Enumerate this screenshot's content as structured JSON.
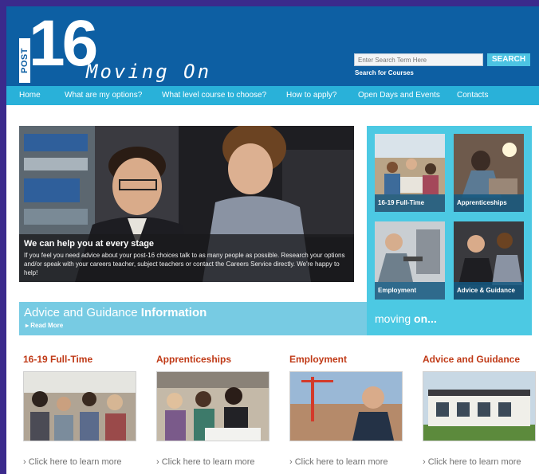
{
  "logo": {
    "post": "POST",
    "number": "16",
    "tagline": "Moving On"
  },
  "search": {
    "placeholder": "Enter Search Term Here",
    "button_label": "SEARCH",
    "courses_link": "Search for Courses"
  },
  "nav": {
    "items": [
      "Home",
      "What are my options?",
      "What level course to choose?",
      "How to apply?",
      "Open Days and Events",
      "Contacts"
    ]
  },
  "hero": {
    "title": "We can help you at every stage",
    "text": "If you feel you need advice about your post-16 choices talk to as many people as possible. Research your options and/or speak with your careers teacher, subject teachers or contact the Careers Service directly. We're happy to help!"
  },
  "advice": {
    "title_part1": "Advice and Guidance",
    "title_part2": "Information",
    "read_more": "Read More"
  },
  "side": {
    "tiles": [
      "16-19 Full-Time",
      "Apprenticeships",
      "Employment",
      "Advice & Guidance"
    ],
    "moving_on_part1": "moving",
    "moving_on_part2": "on..."
  },
  "columns": [
    {
      "title": "16-19 Full-Time",
      "link": "Click here to learn more"
    },
    {
      "title": "Apprenticeships",
      "link": "Click here to learn more"
    },
    {
      "title": "Employment",
      "link": "Click here to learn more"
    },
    {
      "title": "Advice and Guidance",
      "link": "Click here to learn more"
    }
  ],
  "colors": {
    "header": "#0d5fa3",
    "nav": "#29b1d9",
    "side_panel": "#4cc9e3",
    "advice_bar": "#77cbe3",
    "column_title": "#c03a17",
    "search_button": "#4cc3e2",
    "outer_border": "#3b2a8c"
  }
}
